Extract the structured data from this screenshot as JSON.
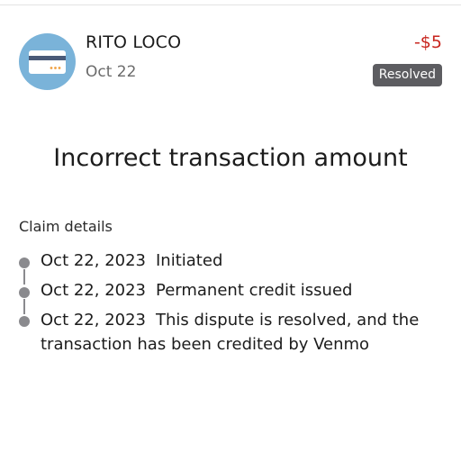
{
  "transaction": {
    "merchant": "RITO LOCO",
    "date": "Oct 22",
    "amount": "-$5",
    "status": "Resolved"
  },
  "claim": {
    "title": "Incorrect transaction amount",
    "details_label": "Claim details",
    "events": [
      {
        "date": "Oct 22, 2023",
        "text": "Initiated"
      },
      {
        "date": "Oct 22, 2023",
        "text": "Permanent credit issued"
      },
      {
        "date": "Oct 22, 2023",
        "text": "This dispute is resolved, and the transaction has been credited by Venmo"
      }
    ]
  },
  "colors": {
    "avatar_bg": "#7ab3d9",
    "amount_negative": "#c8261f",
    "badge_bg": "#5d5d61",
    "timeline": "#8a8a8e"
  },
  "icons": {
    "merchant": "credit-card-icon"
  }
}
